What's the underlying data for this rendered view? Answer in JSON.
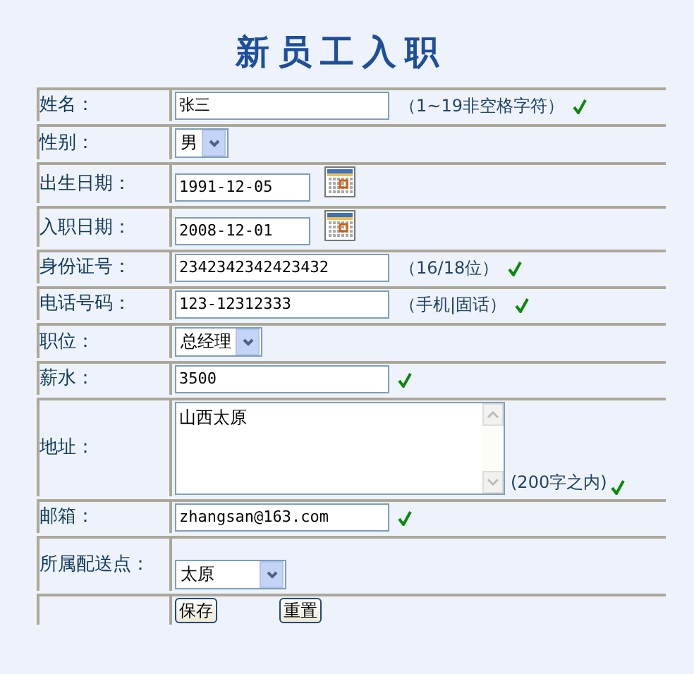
{
  "title": "新员工入职",
  "rows": [
    {
      "label": "姓名：",
      "kind": "text",
      "value": "张三",
      "hint": "（1~19非空格字符）",
      "valid": true
    },
    {
      "label": "性别：",
      "kind": "select",
      "value": "男"
    },
    {
      "label": "出生日期：",
      "kind": "date",
      "value": "1991-12-05"
    },
    {
      "label": "入职日期：",
      "kind": "date",
      "value": "2008-12-01"
    },
    {
      "label": "身份证号：",
      "kind": "text",
      "value": "2342342342423432",
      "hint": "（16/18位）",
      "valid": true
    },
    {
      "label": "电话号码：",
      "kind": "text",
      "value": "123-12312333",
      "hint": "（手机|固话）",
      "valid": true
    },
    {
      "label": "职位：",
      "kind": "select",
      "value": "总经理"
    },
    {
      "label": "薪水：",
      "kind": "text",
      "value": "3500",
      "valid": true
    },
    {
      "label": "地址：",
      "kind": "textarea",
      "value": "山西太原",
      "hint": "(200字之内)",
      "valid": true
    },
    {
      "label": "邮箱：",
      "kind": "text",
      "value": "zhangsan@163.com",
      "valid": true
    },
    {
      "label": "所属配送点：",
      "kind": "select-low",
      "value": "太原"
    }
  ],
  "buttons": [
    "保存",
    "重置"
  ]
}
